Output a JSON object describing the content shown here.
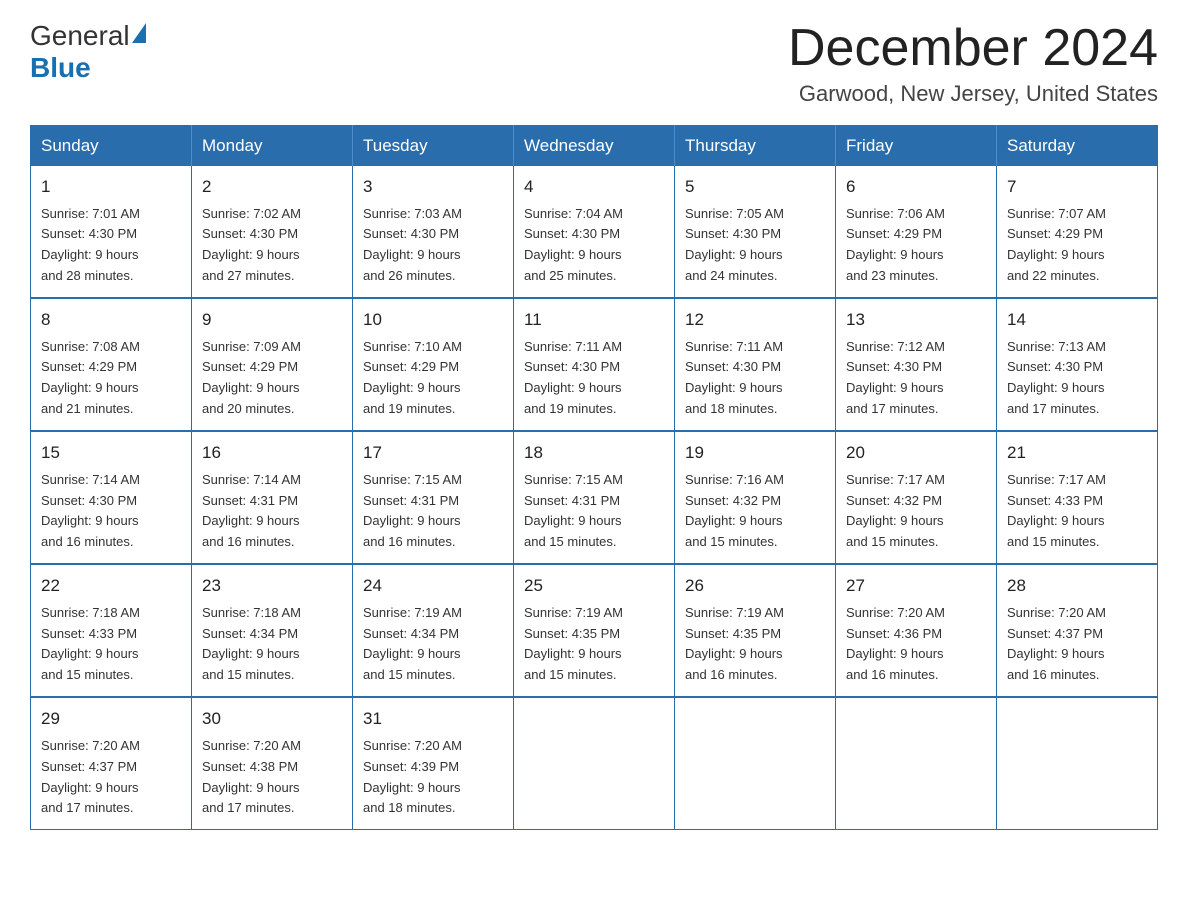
{
  "header": {
    "title": "December 2024",
    "subtitle": "Garwood, New Jersey, United States",
    "logo_general": "General",
    "logo_blue": "Blue"
  },
  "days_of_week": [
    "Sunday",
    "Monday",
    "Tuesday",
    "Wednesday",
    "Thursday",
    "Friday",
    "Saturday"
  ],
  "weeks": [
    [
      {
        "day": "1",
        "sunrise": "7:01 AM",
        "sunset": "4:30 PM",
        "daylight_hours": "9",
        "daylight_minutes": "28"
      },
      {
        "day": "2",
        "sunrise": "7:02 AM",
        "sunset": "4:30 PM",
        "daylight_hours": "9",
        "daylight_minutes": "27"
      },
      {
        "day": "3",
        "sunrise": "7:03 AM",
        "sunset": "4:30 PM",
        "daylight_hours": "9",
        "daylight_minutes": "26"
      },
      {
        "day": "4",
        "sunrise": "7:04 AM",
        "sunset": "4:30 PM",
        "daylight_hours": "9",
        "daylight_minutes": "25"
      },
      {
        "day": "5",
        "sunrise": "7:05 AM",
        "sunset": "4:30 PM",
        "daylight_hours": "9",
        "daylight_minutes": "24"
      },
      {
        "day": "6",
        "sunrise": "7:06 AM",
        "sunset": "4:29 PM",
        "daylight_hours": "9",
        "daylight_minutes": "23"
      },
      {
        "day": "7",
        "sunrise": "7:07 AM",
        "sunset": "4:29 PM",
        "daylight_hours": "9",
        "daylight_minutes": "22"
      }
    ],
    [
      {
        "day": "8",
        "sunrise": "7:08 AM",
        "sunset": "4:29 PM",
        "daylight_hours": "9",
        "daylight_minutes": "21"
      },
      {
        "day": "9",
        "sunrise": "7:09 AM",
        "sunset": "4:29 PM",
        "daylight_hours": "9",
        "daylight_minutes": "20"
      },
      {
        "day": "10",
        "sunrise": "7:10 AM",
        "sunset": "4:29 PM",
        "daylight_hours": "9",
        "daylight_minutes": "19"
      },
      {
        "day": "11",
        "sunrise": "7:11 AM",
        "sunset": "4:30 PM",
        "daylight_hours": "9",
        "daylight_minutes": "19"
      },
      {
        "day": "12",
        "sunrise": "7:11 AM",
        "sunset": "4:30 PM",
        "daylight_hours": "9",
        "daylight_minutes": "18"
      },
      {
        "day": "13",
        "sunrise": "7:12 AM",
        "sunset": "4:30 PM",
        "daylight_hours": "9",
        "daylight_minutes": "17"
      },
      {
        "day": "14",
        "sunrise": "7:13 AM",
        "sunset": "4:30 PM",
        "daylight_hours": "9",
        "daylight_minutes": "17"
      }
    ],
    [
      {
        "day": "15",
        "sunrise": "7:14 AM",
        "sunset": "4:30 PM",
        "daylight_hours": "9",
        "daylight_minutes": "16"
      },
      {
        "day": "16",
        "sunrise": "7:14 AM",
        "sunset": "4:31 PM",
        "daylight_hours": "9",
        "daylight_minutes": "16"
      },
      {
        "day": "17",
        "sunrise": "7:15 AM",
        "sunset": "4:31 PM",
        "daylight_hours": "9",
        "daylight_minutes": "16"
      },
      {
        "day": "18",
        "sunrise": "7:15 AM",
        "sunset": "4:31 PM",
        "daylight_hours": "9",
        "daylight_minutes": "15"
      },
      {
        "day": "19",
        "sunrise": "7:16 AM",
        "sunset": "4:32 PM",
        "daylight_hours": "9",
        "daylight_minutes": "15"
      },
      {
        "day": "20",
        "sunrise": "7:17 AM",
        "sunset": "4:32 PM",
        "daylight_hours": "9",
        "daylight_minutes": "15"
      },
      {
        "day": "21",
        "sunrise": "7:17 AM",
        "sunset": "4:33 PM",
        "daylight_hours": "9",
        "daylight_minutes": "15"
      }
    ],
    [
      {
        "day": "22",
        "sunrise": "7:18 AM",
        "sunset": "4:33 PM",
        "daylight_hours": "9",
        "daylight_minutes": "15"
      },
      {
        "day": "23",
        "sunrise": "7:18 AM",
        "sunset": "4:34 PM",
        "daylight_hours": "9",
        "daylight_minutes": "15"
      },
      {
        "day": "24",
        "sunrise": "7:19 AM",
        "sunset": "4:34 PM",
        "daylight_hours": "9",
        "daylight_minutes": "15"
      },
      {
        "day": "25",
        "sunrise": "7:19 AM",
        "sunset": "4:35 PM",
        "daylight_hours": "9",
        "daylight_minutes": "15"
      },
      {
        "day": "26",
        "sunrise": "7:19 AM",
        "sunset": "4:35 PM",
        "daylight_hours": "9",
        "daylight_minutes": "16"
      },
      {
        "day": "27",
        "sunrise": "7:20 AM",
        "sunset": "4:36 PM",
        "daylight_hours": "9",
        "daylight_minutes": "16"
      },
      {
        "day": "28",
        "sunrise": "7:20 AM",
        "sunset": "4:37 PM",
        "daylight_hours": "9",
        "daylight_minutes": "16"
      }
    ],
    [
      {
        "day": "29",
        "sunrise": "7:20 AM",
        "sunset": "4:37 PM",
        "daylight_hours": "9",
        "daylight_minutes": "17"
      },
      {
        "day": "30",
        "sunrise": "7:20 AM",
        "sunset": "4:38 PM",
        "daylight_hours": "9",
        "daylight_minutes": "17"
      },
      {
        "day": "31",
        "sunrise": "7:20 AM",
        "sunset": "4:39 PM",
        "daylight_hours": "9",
        "daylight_minutes": "18"
      },
      null,
      null,
      null,
      null
    ]
  ],
  "labels": {
    "sunrise": "Sunrise:",
    "sunset": "Sunset:",
    "daylight": "Daylight: 9 hours"
  }
}
